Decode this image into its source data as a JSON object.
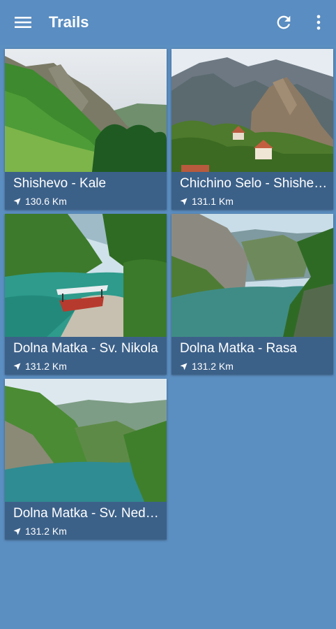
{
  "appbar": {
    "title": "Trails",
    "menu_icon": "menu-icon",
    "refresh_icon": "refresh-icon",
    "more_icon": "more-vert-icon"
  },
  "colors": {
    "background": "#5b8ec1",
    "card_info": "#3c6189",
    "text": "#ffffff"
  },
  "trails": [
    {
      "name": "Shishevo - Kale",
      "distance": "130.6 Km"
    },
    {
      "name": "Chichino Selo - Shishevo",
      "distance": "131.1 Km"
    },
    {
      "name": "Dolna Matka - Sv. Nikola",
      "distance": "131.2 Km"
    },
    {
      "name": "Dolna Matka - Rasa",
      "distance": "131.2 Km"
    },
    {
      "name": "Dolna Matka - Sv. Nedela",
      "distance": "131.2 Km"
    }
  ]
}
